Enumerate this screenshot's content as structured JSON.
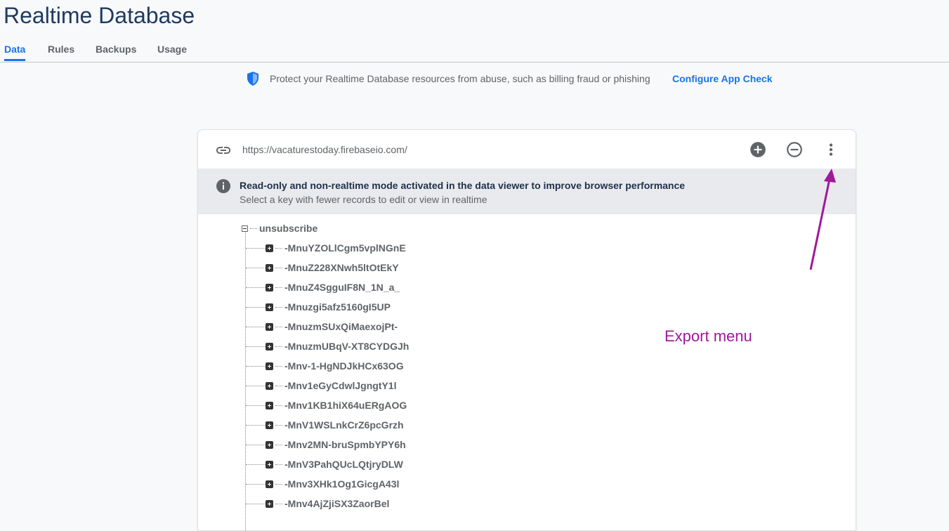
{
  "page": {
    "title": "Realtime Database"
  },
  "tabs": [
    {
      "label": "Data",
      "active": true
    },
    {
      "label": "Rules",
      "active": false
    },
    {
      "label": "Backups",
      "active": false
    },
    {
      "label": "Usage",
      "active": false
    }
  ],
  "banner": {
    "message": "Protect your Realtime Database resources from abuse, such as billing fraud or phishing",
    "link": "Configure App Check",
    "icon": "shield-icon"
  },
  "viewer": {
    "url": "https://vacaturestoday.firebaseio.com/",
    "actions": {
      "add_icon": "add-circle-icon",
      "remove_icon": "remove-circle-icon",
      "more_icon": "more-vertical-icon"
    },
    "info_title": "Read-only and non-realtime mode activated in the data viewer to improve browser performance",
    "info_subtitle": "Select a key with fewer records to edit or view in realtime"
  },
  "tree": {
    "root": "unsubscribe",
    "children": [
      "-MnuYZOLlCgm5vplNGnE",
      "-MnuZ228XNwh5ltOtEkY",
      "-MnuZ4SgguIF8N_1N_a_",
      "-Mnuzgi5afz5160gI5UP",
      "-MnuzmSUxQiMaexojPt-",
      "-MnuzmUBqV-XT8CYDGJh",
      "-Mnv-1-HgNDJkHCx63OG",
      "-Mnv1eGyCdwlJgngtY1l",
      "-Mnv1KB1hiX64uERgAOG",
      "-MnV1WSLnkCrZ6pcGrzh",
      "-Mnv2MN-bruSpmbYPY6h",
      "-MnV3PahQUcLQtjryDLW",
      "-Mnv3XHk1Og1GicgA43l",
      "-Mnv4AjZjiSX3ZaorBel"
    ]
  },
  "annotation": {
    "label": "Export menu",
    "color": "#a0189b"
  }
}
